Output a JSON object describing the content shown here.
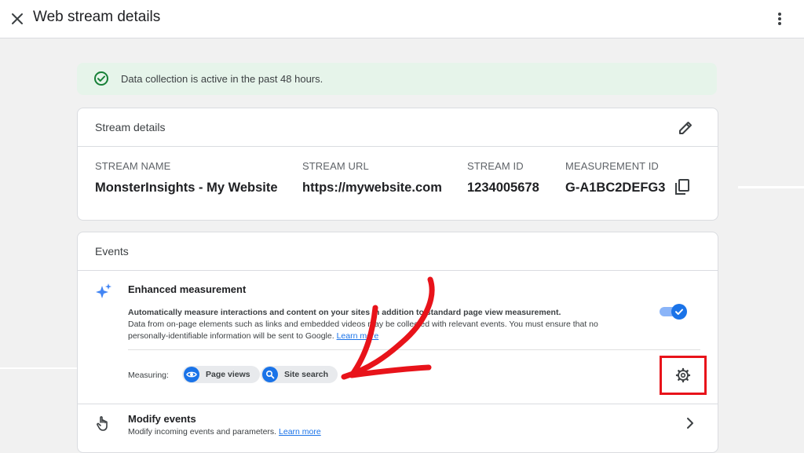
{
  "header": {
    "title": "Web stream details"
  },
  "banner": {
    "text": "Data collection is active in the past 48 hours."
  },
  "stream_details": {
    "title": "Stream details",
    "columns": [
      {
        "label": "STREAM NAME",
        "value": "MonsterInsights - My Website"
      },
      {
        "label": "STREAM URL",
        "value": "https://mywebsite.com"
      },
      {
        "label": "STREAM ID",
        "value": "1234005678"
      },
      {
        "label": "MEASUREMENT ID",
        "value": "G-A1BC2DEFG3"
      }
    ]
  },
  "events": {
    "title": "Events",
    "enhanced_measurement": {
      "title": "Enhanced measurement",
      "desc_line1": "Automatically measure interactions and content on your sites in addition to standard page view measurement.",
      "desc_line2": "Data from on-page elements such as links and embedded videos may be collected with relevant events. You must ensure that no personally-identifiable information will be sent to Google.",
      "learn_more": "Learn more",
      "toggle_on": true,
      "measuring_label": "Measuring:",
      "chips": [
        {
          "label": "Page views",
          "icon": "eye-icon"
        },
        {
          "label": "Site search",
          "icon": "search-icon"
        }
      ]
    },
    "modify_events": {
      "title": "Modify events",
      "desc": "Modify incoming events and parameters.",
      "learn_more": "Learn more"
    }
  },
  "colors": {
    "accent": "#1a73e8",
    "banner_bg": "#e6f4ea",
    "success": "#188038",
    "annotation": "#e8131a"
  }
}
